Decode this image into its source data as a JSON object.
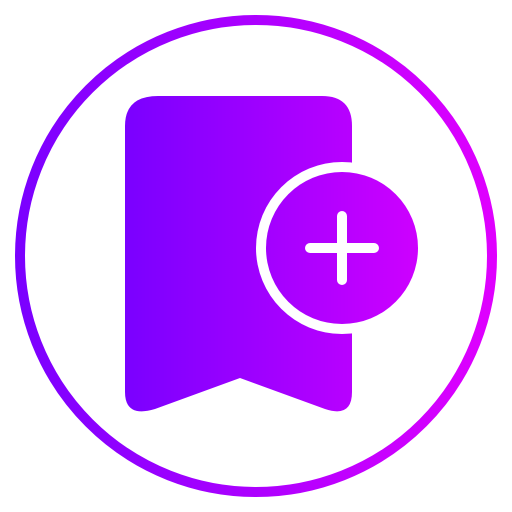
{
  "icon": {
    "name": "add-bookmark-icon",
    "badge_icon": "plus-icon",
    "ring_icon": "circle-outline-icon"
  },
  "colors": {
    "gradient_start": "#7a00ff",
    "gradient_end": "#e000ff",
    "background": "#ffffff",
    "inner_white": "#ffffff"
  }
}
